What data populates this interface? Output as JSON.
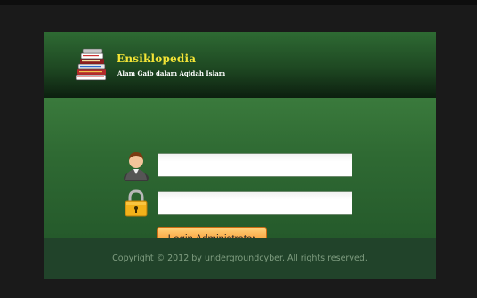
{
  "header": {
    "title": "Ensiklopedia",
    "subtitle": "Alam Gaib dalam Aqidah Islam",
    "logo_icon": "books-icon"
  },
  "login_form": {
    "username": {
      "icon": "user-avatar-icon",
      "value": "",
      "placeholder": ""
    },
    "password": {
      "icon": "padlock-icon",
      "value": "",
      "placeholder": ""
    },
    "submit_label": "Login Administrator"
  },
  "footer": {
    "copyright": "Copyright © 2012 by undergroundcyber. All rights reserved."
  },
  "colors": {
    "page_background": "#1a1a1a",
    "panel_green": "#2b5a30",
    "title_yellow": "#f3e436",
    "button_orange": "#f9a23e",
    "footer_text": "#7f9d80"
  }
}
